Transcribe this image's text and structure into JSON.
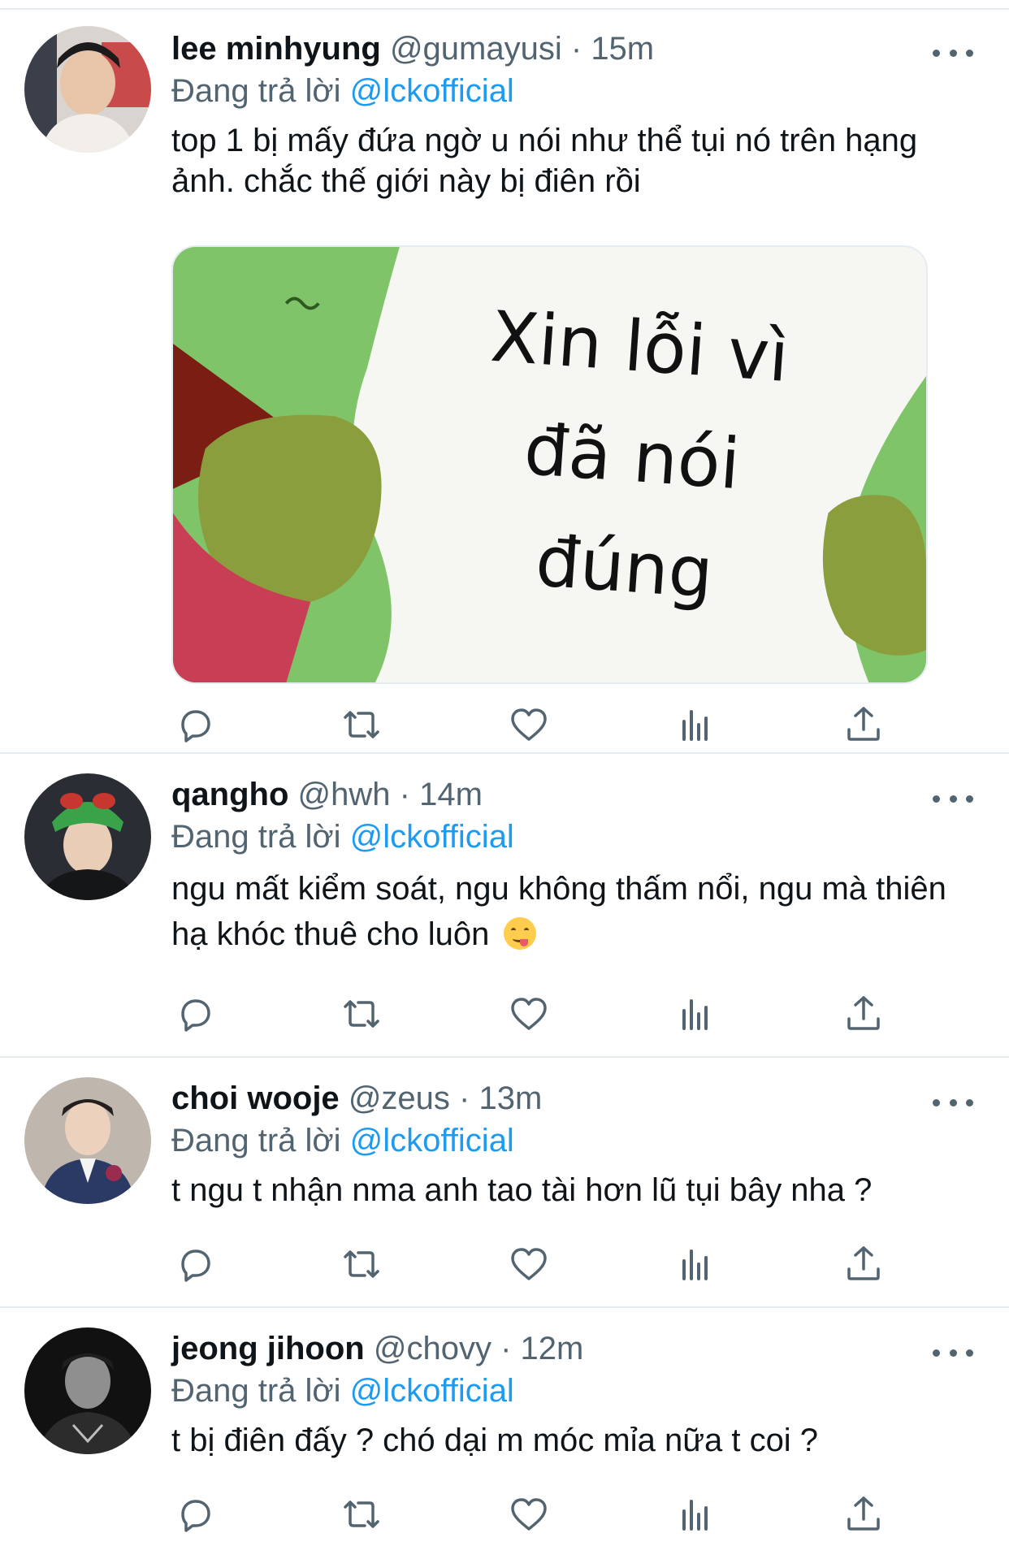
{
  "tweets": [
    {
      "name": "lee minhyung",
      "handle": "@gumayusi",
      "dot": "·",
      "time": "15m",
      "reply_prefix": "Đang trả lời",
      "reply_to": "@lckofficial",
      "text": "top 1 bị mấy đứa ngờ u nói như thể tụi nó trên hạng ảnh. chắc thế giới này bị điên rồi",
      "media": {
        "line1": "Xin lỗi vì",
        "line2": "đã nói",
        "line3": "đúng"
      }
    },
    {
      "name": "qangho",
      "handle": "@hwh",
      "dot": "·",
      "time": "14m",
      "reply_prefix": "Đang trả lời",
      "reply_to": "@lckofficial",
      "text": "ngu mất kiểm soát, ngu không thấm nổi, ngu mà thiên hạ khóc thuê cho luôn"
    },
    {
      "name": "choi wooje",
      "handle": "@zeus",
      "dot": "·",
      "time": "13m",
      "reply_prefix": "Đang trả lời",
      "reply_to": "@lckofficial",
      "text": "t ngu t nhận nma anh tao tài hơn lũ tụi bây nha ?"
    },
    {
      "name": "jeong jihoon",
      "handle": "@chovy",
      "dot": "·",
      "time": "12m",
      "reply_prefix": "Đang trả lời",
      "reply_to": "@lckofficial",
      "text": "t bị điên đấy ? chó dại m móc mỉa nữa t coi ?"
    }
  ],
  "icons": {
    "reply": "reply-icon",
    "retweet": "retweet-icon",
    "like": "like-icon",
    "analytics": "analytics-icon",
    "share": "share-icon",
    "more": "more-icon"
  },
  "colors": {
    "mention": "#1d9bf0",
    "secondary_text": "#536471",
    "primary_text": "#0f1419",
    "divider": "#e6ecf0"
  }
}
